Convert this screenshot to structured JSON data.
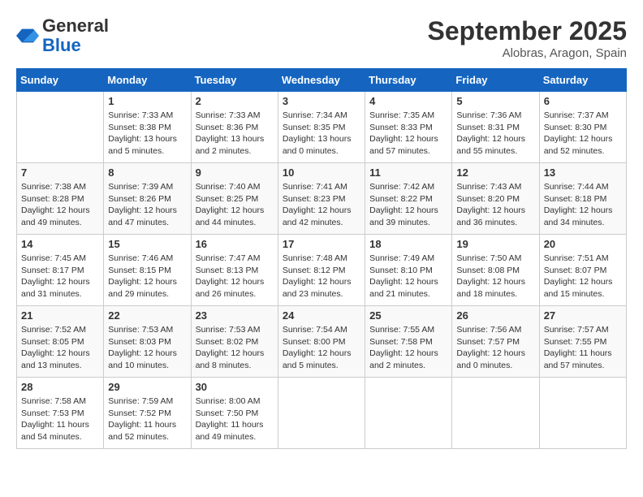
{
  "header": {
    "logo_line1": "General",
    "logo_line2": "Blue",
    "month_year": "September 2025",
    "location": "Alobras, Aragon, Spain"
  },
  "days_of_week": [
    "Sunday",
    "Monday",
    "Tuesday",
    "Wednesday",
    "Thursday",
    "Friday",
    "Saturday"
  ],
  "weeks": [
    [
      {
        "day": "",
        "detail": ""
      },
      {
        "day": "1",
        "detail": "Sunrise: 7:33 AM\nSunset: 8:38 PM\nDaylight: 13 hours\nand 5 minutes."
      },
      {
        "day": "2",
        "detail": "Sunrise: 7:33 AM\nSunset: 8:36 PM\nDaylight: 13 hours\nand 2 minutes."
      },
      {
        "day": "3",
        "detail": "Sunrise: 7:34 AM\nSunset: 8:35 PM\nDaylight: 13 hours\nand 0 minutes."
      },
      {
        "day": "4",
        "detail": "Sunrise: 7:35 AM\nSunset: 8:33 PM\nDaylight: 12 hours\nand 57 minutes."
      },
      {
        "day": "5",
        "detail": "Sunrise: 7:36 AM\nSunset: 8:31 PM\nDaylight: 12 hours\nand 55 minutes."
      },
      {
        "day": "6",
        "detail": "Sunrise: 7:37 AM\nSunset: 8:30 PM\nDaylight: 12 hours\nand 52 minutes."
      }
    ],
    [
      {
        "day": "7",
        "detail": "Sunrise: 7:38 AM\nSunset: 8:28 PM\nDaylight: 12 hours\nand 49 minutes."
      },
      {
        "day": "8",
        "detail": "Sunrise: 7:39 AM\nSunset: 8:26 PM\nDaylight: 12 hours\nand 47 minutes."
      },
      {
        "day": "9",
        "detail": "Sunrise: 7:40 AM\nSunset: 8:25 PM\nDaylight: 12 hours\nand 44 minutes."
      },
      {
        "day": "10",
        "detail": "Sunrise: 7:41 AM\nSunset: 8:23 PM\nDaylight: 12 hours\nand 42 minutes."
      },
      {
        "day": "11",
        "detail": "Sunrise: 7:42 AM\nSunset: 8:22 PM\nDaylight: 12 hours\nand 39 minutes."
      },
      {
        "day": "12",
        "detail": "Sunrise: 7:43 AM\nSunset: 8:20 PM\nDaylight: 12 hours\nand 36 minutes."
      },
      {
        "day": "13",
        "detail": "Sunrise: 7:44 AM\nSunset: 8:18 PM\nDaylight: 12 hours\nand 34 minutes."
      }
    ],
    [
      {
        "day": "14",
        "detail": "Sunrise: 7:45 AM\nSunset: 8:17 PM\nDaylight: 12 hours\nand 31 minutes."
      },
      {
        "day": "15",
        "detail": "Sunrise: 7:46 AM\nSunset: 8:15 PM\nDaylight: 12 hours\nand 29 minutes."
      },
      {
        "day": "16",
        "detail": "Sunrise: 7:47 AM\nSunset: 8:13 PM\nDaylight: 12 hours\nand 26 minutes."
      },
      {
        "day": "17",
        "detail": "Sunrise: 7:48 AM\nSunset: 8:12 PM\nDaylight: 12 hours\nand 23 minutes."
      },
      {
        "day": "18",
        "detail": "Sunrise: 7:49 AM\nSunset: 8:10 PM\nDaylight: 12 hours\nand 21 minutes."
      },
      {
        "day": "19",
        "detail": "Sunrise: 7:50 AM\nSunset: 8:08 PM\nDaylight: 12 hours\nand 18 minutes."
      },
      {
        "day": "20",
        "detail": "Sunrise: 7:51 AM\nSunset: 8:07 PM\nDaylight: 12 hours\nand 15 minutes."
      }
    ],
    [
      {
        "day": "21",
        "detail": "Sunrise: 7:52 AM\nSunset: 8:05 PM\nDaylight: 12 hours\nand 13 minutes."
      },
      {
        "day": "22",
        "detail": "Sunrise: 7:53 AM\nSunset: 8:03 PM\nDaylight: 12 hours\nand 10 minutes."
      },
      {
        "day": "23",
        "detail": "Sunrise: 7:53 AM\nSunset: 8:02 PM\nDaylight: 12 hours\nand 8 minutes."
      },
      {
        "day": "24",
        "detail": "Sunrise: 7:54 AM\nSunset: 8:00 PM\nDaylight: 12 hours\nand 5 minutes."
      },
      {
        "day": "25",
        "detail": "Sunrise: 7:55 AM\nSunset: 7:58 PM\nDaylight: 12 hours\nand 2 minutes."
      },
      {
        "day": "26",
        "detail": "Sunrise: 7:56 AM\nSunset: 7:57 PM\nDaylight: 12 hours\nand 0 minutes."
      },
      {
        "day": "27",
        "detail": "Sunrise: 7:57 AM\nSunset: 7:55 PM\nDaylight: 11 hours\nand 57 minutes."
      }
    ],
    [
      {
        "day": "28",
        "detail": "Sunrise: 7:58 AM\nSunset: 7:53 PM\nDaylight: 11 hours\nand 54 minutes."
      },
      {
        "day": "29",
        "detail": "Sunrise: 7:59 AM\nSunset: 7:52 PM\nDaylight: 11 hours\nand 52 minutes."
      },
      {
        "day": "30",
        "detail": "Sunrise: 8:00 AM\nSunset: 7:50 PM\nDaylight: 11 hours\nand 49 minutes."
      },
      {
        "day": "",
        "detail": ""
      },
      {
        "day": "",
        "detail": ""
      },
      {
        "day": "",
        "detail": ""
      },
      {
        "day": "",
        "detail": ""
      }
    ]
  ]
}
